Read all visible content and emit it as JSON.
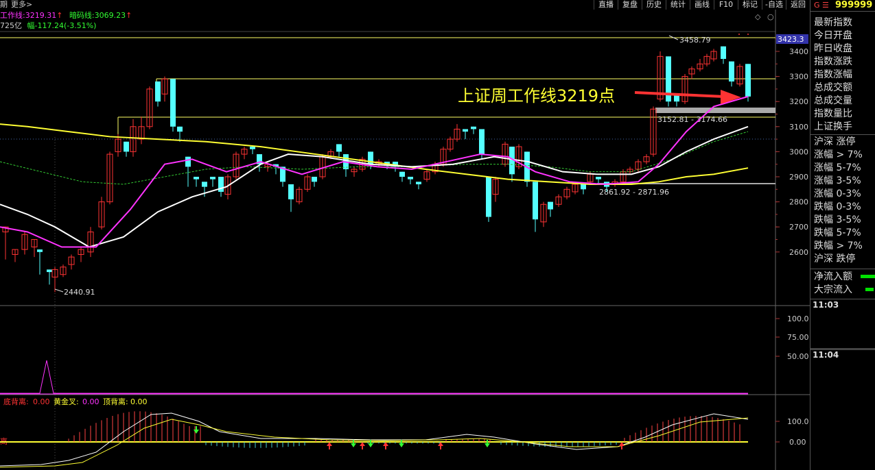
{
  "topbar": {
    "left_labels": [
      "期",
      "更多>"
    ],
    "buttons": [
      "直播",
      "复盘",
      "历史",
      "统计",
      "画线",
      "F10",
      "标记",
      "-自选",
      "返回"
    ]
  },
  "header": {
    "work_line_label": "工作线:",
    "work_line_value": "3219.31",
    "dark_code_label": "暗码线:",
    "dark_code_value": "3069.23",
    "volume_text": "725亿",
    "change_label": "幅",
    "change_value": "-117.24(-3.51%)"
  },
  "chart_main": {
    "price_tag": "3423.3",
    "annotation": "上证周工作线3219点",
    "high_label": "3458.79",
    "low_label": "2440.91",
    "zone1_label": "3152.81 - 3174.66",
    "zone2_label": "2861.92 - 2871.96",
    "yaxis_ticks": [
      "3400",
      "3300",
      "3200",
      "3100",
      "3000",
      "2900",
      "2800",
      "2700",
      "2600"
    ]
  },
  "chart_sub1": {
    "yaxis_ticks": [
      "100.0",
      "75.00",
      "50.00"
    ]
  },
  "chart_sub2": {
    "label_bottom_divergence": "底背离:",
    "value_bottom_divergence": "0.00",
    "label_golden_cross": "黄金叉:",
    "value_golden_cross": "0.00",
    "label_top_divergence": "顶背离:",
    "value_top_divergence": "0.00",
    "left_edge_label": "离",
    "yaxis_ticks": [
      "100.0",
      "0.00"
    ]
  },
  "right_panel": {
    "code_prefix": "G ☰",
    "code": "999999",
    "items": [
      "最新指数",
      "今日开盘",
      "昨日收盘",
      "指数涨跌",
      "指数涨幅",
      "总成交额",
      "总成交量",
      "指数量比",
      "上证换手"
    ],
    "stats": [
      "沪深 涨停",
      "涨幅 > 7%",
      "涨幅 5-7%",
      "涨幅 3-5%",
      "涨幅 0-3%",
      "跌幅 0-3%",
      "跌幅 3-5%",
      "跌幅 5-7%",
      "跌幅 > 7%",
      "沪深 跌停"
    ],
    "flows": [
      "净流入额",
      "大宗流入"
    ],
    "times": [
      "11:03",
      "11:04"
    ]
  },
  "colors": {
    "up": "#ff3333",
    "down": "#54ffff",
    "ma_white": "#ffffff",
    "ma_magenta": "#ff33ff",
    "ma_yellow": "#ffff33",
    "ma_green_dash": "#33cc33",
    "annotation": "#ffff33"
  }
}
